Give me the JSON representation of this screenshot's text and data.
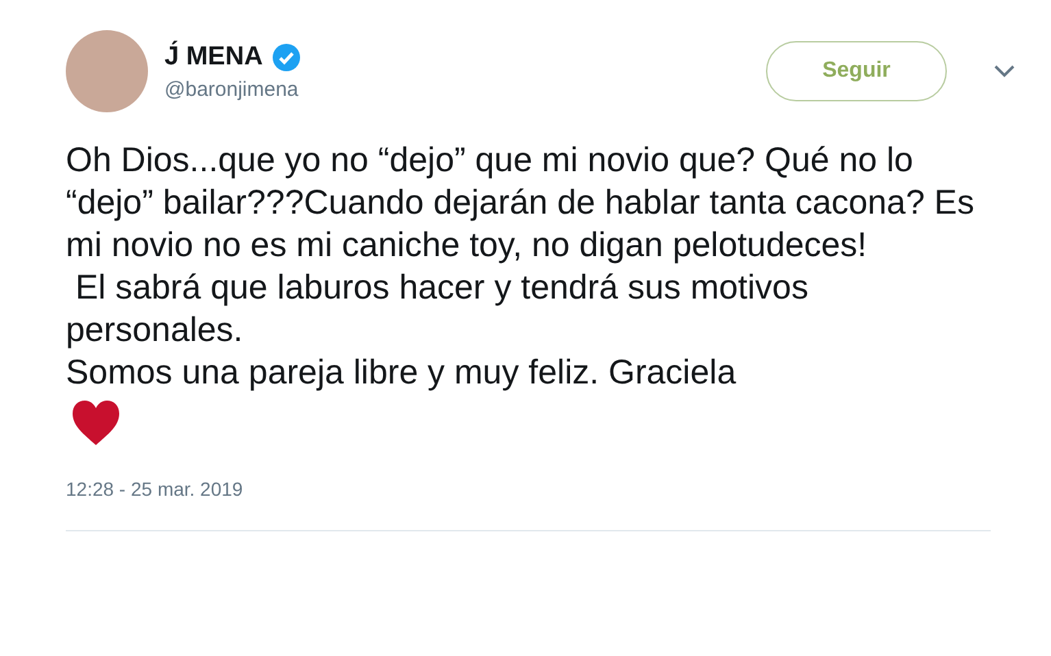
{
  "author": {
    "name": "J́ MENA",
    "handle": "@baronjimena"
  },
  "follow_button": {
    "label": "Seguir"
  },
  "tweet": {
    "paragraphs": [
      "Oh Dios...que yo no “dejo” que mi novio que? Qué no lo “dejo” bailar???Cuando dejarán de hablar tanta cacona? Es mi novio no es mi caniche toy, no digan pelotudeces!",
      " El sabrá que laburos hacer y tendrá sus motivos personales.",
      "Somos una pareja libre y muy feliz. Graciela"
    ],
    "timestamp": "12:28 - 25 mar. 2019"
  }
}
